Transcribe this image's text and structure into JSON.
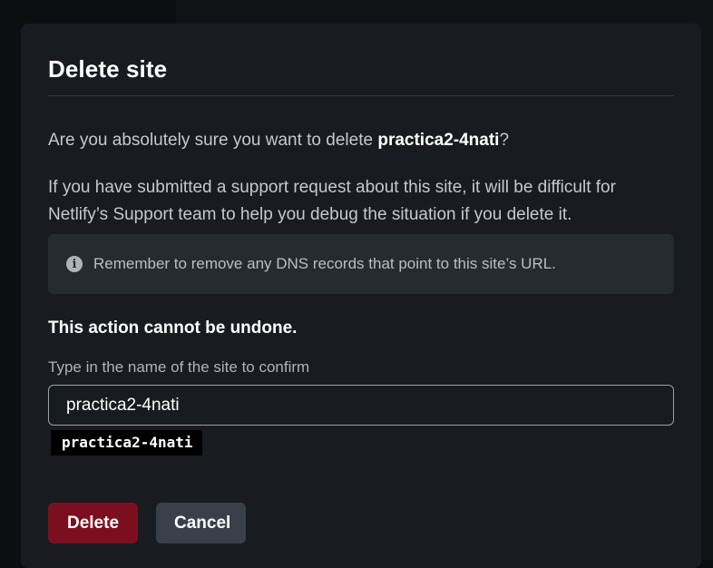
{
  "modal": {
    "title": "Delete site",
    "confirm_prefix": "Are you absolutely sure you want to delete ",
    "site_name": "practica2-4nati",
    "confirm_suffix": "?",
    "support_text": "If you have submitted a support request about this site, it will be difficult for Netlify’s Support team to help you debug the situation if you delete it.",
    "note": {
      "icon": "info-icon",
      "text": "Remember to remove any DNS records that point to this site’s URL."
    },
    "warning": "This action cannot be undone.",
    "field": {
      "label": "Type in the name of the site to confirm",
      "value": "practica2-4nati",
      "hint": "practica2-4nati"
    },
    "buttons": {
      "delete_label": "Delete",
      "cancel_label": "Cancel"
    },
    "colors": {
      "delete": "#7c0f1f",
      "cancel": "#3a4049",
      "surface": "#181b20"
    }
  }
}
